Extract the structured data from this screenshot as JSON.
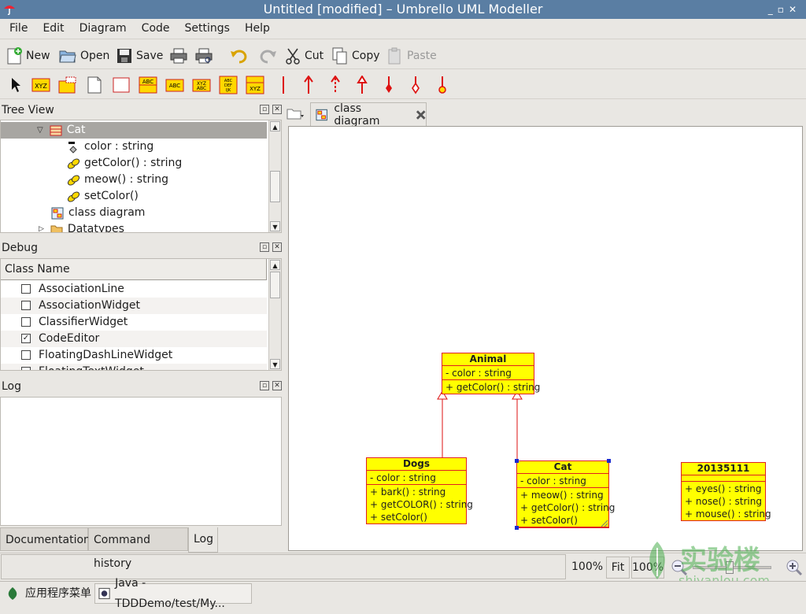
{
  "window": {
    "title": "Untitled [modified] – Umbrello UML Modeller"
  },
  "menu": [
    "File",
    "Edit",
    "Diagram",
    "Code",
    "Settings",
    "Help"
  ],
  "toolbar": {
    "new_label": "New",
    "open_label": "Open",
    "save_label": "Save",
    "cut_label": "Cut",
    "copy_label": "Copy",
    "paste_label": "Paste"
  },
  "tree_view": {
    "title": "Tree View",
    "items": [
      {
        "label": "Cat",
        "selected": true
      },
      {
        "label": "color : string"
      },
      {
        "label": "getColor() : string"
      },
      {
        "label": "meow() : string"
      },
      {
        "label": "setColor()"
      },
      {
        "label": "class diagram"
      },
      {
        "label": "Datatypes"
      }
    ]
  },
  "debug": {
    "title": "Debug",
    "column_header": "Class Name",
    "rows": [
      {
        "label": "AssociationLine",
        "checked": false
      },
      {
        "label": "AssociationWidget",
        "checked": false
      },
      {
        "label": "ClassifierWidget",
        "checked": false
      },
      {
        "label": "CodeEditor",
        "checked": true
      },
      {
        "label": "FloatingDashLineWidget",
        "checked": false
      },
      {
        "label": "FloatingTextWidget",
        "checked": false
      }
    ]
  },
  "log": {
    "title": "Log"
  },
  "bottom_tabs": [
    "Documentation",
    "Command history",
    "Log"
  ],
  "diagram_tab": {
    "label": "class diagram"
  },
  "diagram": {
    "classes": [
      {
        "name": "Animal",
        "attributes": [
          "- color : string"
        ],
        "operations": [
          "+ getColor() : string"
        ]
      },
      {
        "name": "Dogs",
        "attributes": [
          "- color : string"
        ],
        "operations": [
          "+ bark() : string",
          "+ getCOLOR() : string",
          "+ setColor()"
        ]
      },
      {
        "name": "Cat",
        "attributes": [
          "- color : string"
        ],
        "operations": [
          "+ meow() : string",
          "+ getColor() : string",
          "+ setColor()"
        ]
      },
      {
        "name": "20135111",
        "attributes": [],
        "operations": [
          "+ eyes() : string",
          "+ nose() : string",
          "+ mouse() : string"
        ]
      }
    ]
  },
  "status": {
    "zoom_left": "100%",
    "fit_label": "Fit",
    "zoom_value": "100%"
  },
  "taskbar": {
    "menu_label": "应用程序菜单",
    "task_label": "Java - TDDDemo/test/My..."
  },
  "watermark": {
    "cn": "实验楼",
    "url": "shiyanlou.com"
  },
  "colors": {
    "titlebar": "#5a7ea3",
    "class_fill": "#ffff00",
    "class_border": "#e02020",
    "selection": "#a8a6a2"
  }
}
